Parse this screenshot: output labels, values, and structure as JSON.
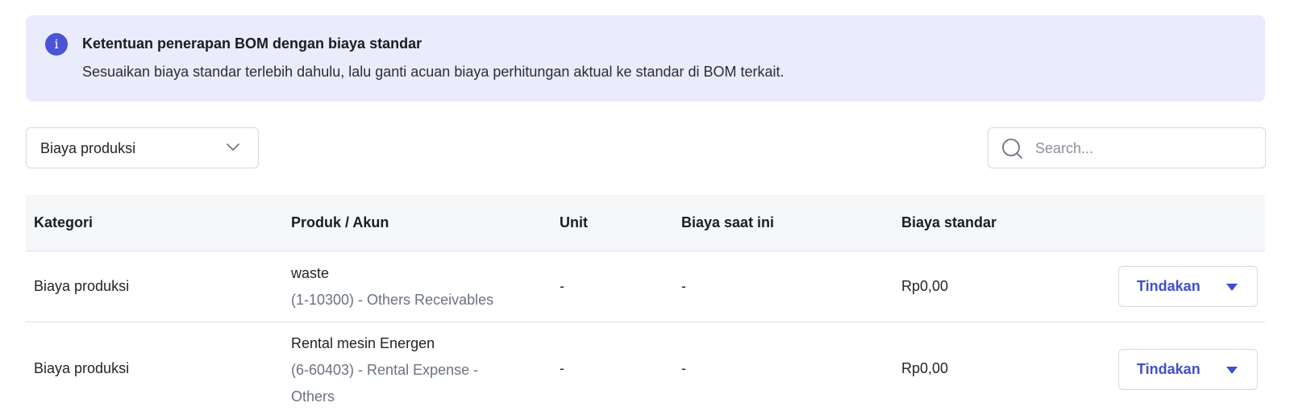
{
  "banner": {
    "icon": "info-icon",
    "icon_glyph": "i",
    "title": "Ketentuan penerapan BOM dengan biaya standar",
    "text": "Sesuaikan biaya standar terlebih dahulu, lalu ganti acuan biaya perhitungan aktual ke standar di BOM terkait."
  },
  "filter": {
    "selected": "Biaya produksi",
    "icon": "chevron-down-icon"
  },
  "search": {
    "placeholder": "Search...",
    "value": "",
    "icon": "search-icon"
  },
  "table": {
    "columns": [
      "Kategori",
      "Produk / Akun",
      "Unit",
      "Biaya saat ini",
      "Biaya standar"
    ],
    "rows": [
      {
        "kategori": "Biaya produksi",
        "produk": "waste",
        "akun": "(1-10300) - Others Receivables",
        "unit": "-",
        "biaya_saat_ini": "-",
        "biaya_standar": "Rp0,00",
        "action_label": "Tindakan"
      },
      {
        "kategori": "Biaya produksi",
        "produk": "Rental mesin Energen",
        "akun": "(6-60403) - Rental Expense - Others",
        "unit": "-",
        "biaya_saat_ini": "-",
        "biaya_standar": "Rp0,00",
        "action_label": "Tindakan"
      }
    ]
  },
  "colors": {
    "accent": "#3e4fd0",
    "banner_bg": "#eaebfb",
    "info_icon": "#4954d6",
    "table_header_bg": "#f6f7f9"
  }
}
